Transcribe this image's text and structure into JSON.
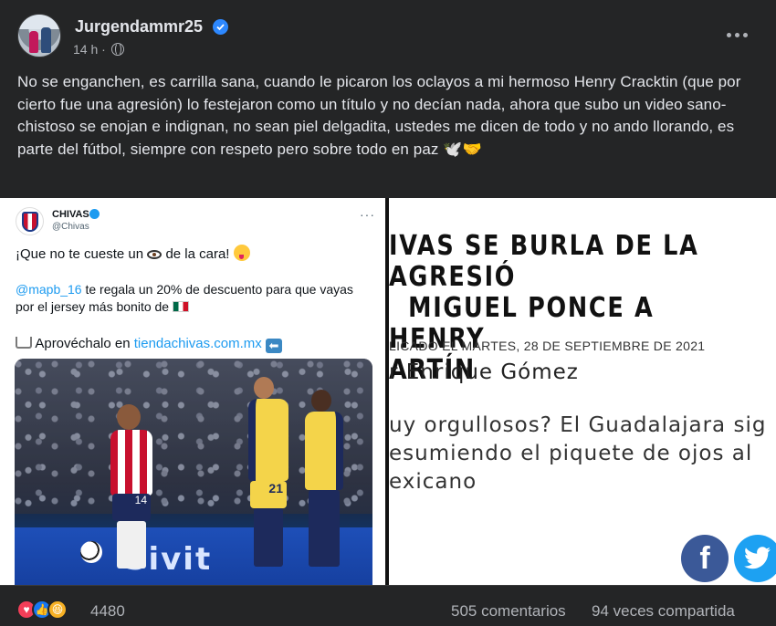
{
  "post": {
    "author": "Jurgendammr25",
    "time": "14 h ·",
    "text": "No se enganchen, es carrilla sana, cuando le picaron los oclayos a mi hermoso Henry Cracktin (que por cierto fue una agresión) lo festejaron como un título y no decían nada, ahora que subo un video sano-chistoso se enojan e indignan, no sean piel delgadita, ustedes me dicen de todo y no ando llorando, es parte del fútbol, siempre con respeto pero sobre todo en paz",
    "emoji_trail": "🕊️🤝"
  },
  "tweet": {
    "name": "CHIVAS",
    "handle": "@Chivas",
    "line1_pre": "¡Que no te cueste un",
    "line1_post": "de la cara!",
    "mention": "@mapb_16",
    "line2": " te regala un 20% de descuento para que vayas por el jersey más bonito de ",
    "line3_pre": "Aprovéchalo en ",
    "link": "tiendachivas.com.mx",
    "arrow": "⬅",
    "photo": {
      "ad_text": "Sivit",
      "jersey_number_1": "14",
      "jersey_number_2": "21"
    }
  },
  "article": {
    "title": "IVAS SE BURLA DE LA AGRESIÓ\n  MIGUEL PONCE A HENRY\nARTÍN",
    "date": "LICADO EL MARTES, 28 DE SEPTIEMBRE DE 2021",
    "author": "r Enrique Gómez",
    "body": "uy orgullosos? El Guadalajara sig\nesumiendo el piquete de ojos al\nexicano",
    "share_fb": "f"
  },
  "footer": {
    "reaction_count": "4480",
    "comments": "505 comentarios",
    "shares": "94 veces compartida"
  },
  "colors": {
    "background": "#242526",
    "text": "#e4e6eb",
    "secondary": "#b0b3b8",
    "verified": "#2d88ff",
    "twitter_link": "#1d9bf0"
  }
}
